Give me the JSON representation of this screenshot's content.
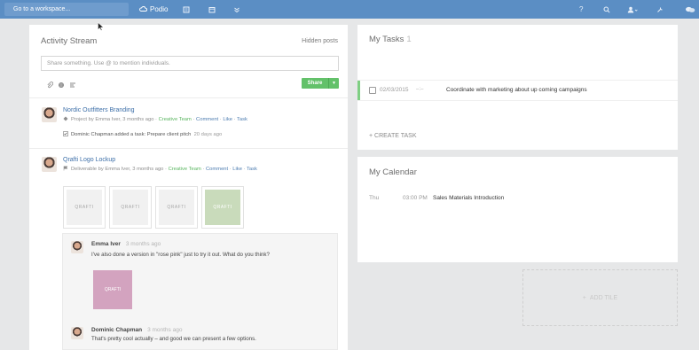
{
  "topbar": {
    "workspace_placeholder": "Go to a workspace...",
    "brand": "Podio",
    "icons": [
      "cloud-icon",
      "document-icon",
      "calendar-icon",
      "chevrons-icon",
      "help-icon",
      "search-icon",
      "user-icon",
      "tools-icon",
      "chat-icon"
    ],
    "help_label": "?",
    "color": "#5b8ec4"
  },
  "activity": {
    "title": "Activity Stream",
    "hidden_posts": "Hidden posts",
    "share_placeholder": "Share something. Use @ to mention individuals.",
    "share_button": "Share",
    "posts": [
      {
        "title": "Nordic Outfitters Branding",
        "meta_prefix": "Project by Emma Iver, 3 months ago",
        "workspace": "Creative Team",
        "actions": [
          "Comment",
          "Like",
          "Task"
        ],
        "sub_text": "Dominic Chapman added a task: Prepare client pitch",
        "sub_time": "20 days ago"
      },
      {
        "title": "Qrafti Logo Lockup",
        "meta_prefix": "Deliverable by Emma Iver, 3 months ago",
        "workspace": "Creative Team",
        "actions": [
          "Comment",
          "Like",
          "Task"
        ],
        "thumbnails": [
          "QRAFTI",
          "QRAFTI",
          "QRAFTI",
          "QRAFTI"
        ]
      }
    ],
    "comments": [
      {
        "author": "Emma Iver",
        "time": "3 months ago",
        "text": "I've also done a version in \"rose pink\" just to try it out. What do you think?",
        "image_label": "QRAFTI"
      },
      {
        "author": "Dominic Chapman",
        "time": "3 months ago",
        "text": "That's pretty cool actually – and good we can present a few options."
      }
    ]
  },
  "tasks": {
    "title": "My Tasks",
    "count": "1",
    "items": [
      {
        "date": "02/03/2015",
        "dash": "–:–",
        "title": "Coordinate with marketing about up coming campaigns"
      }
    ],
    "create_label": "+ CREATE TASK"
  },
  "calendar": {
    "title": "My Calendar",
    "events": [
      {
        "day": "Thu",
        "time": "03:00 PM",
        "title": "Sales Materials Introduction"
      }
    ]
  },
  "add_tile": "ADD TILE",
  "colors": {
    "accent_green": "#63c16a",
    "link_blue": "#3d6fa8"
  }
}
